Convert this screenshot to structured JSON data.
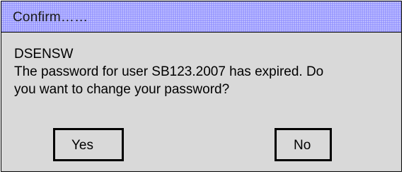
{
  "dialog": {
    "title": "Confirm……",
    "app_name": "DSENSW",
    "message_line1": "The password for user SB123.2007 has expired. Do",
    "message_line2": "you want to change your password?",
    "yes_label": "Yes",
    "no_label": "No"
  },
  "colors": {
    "titlebar": "#9999ff",
    "background": "#d9d9d9",
    "border": "#000000"
  }
}
